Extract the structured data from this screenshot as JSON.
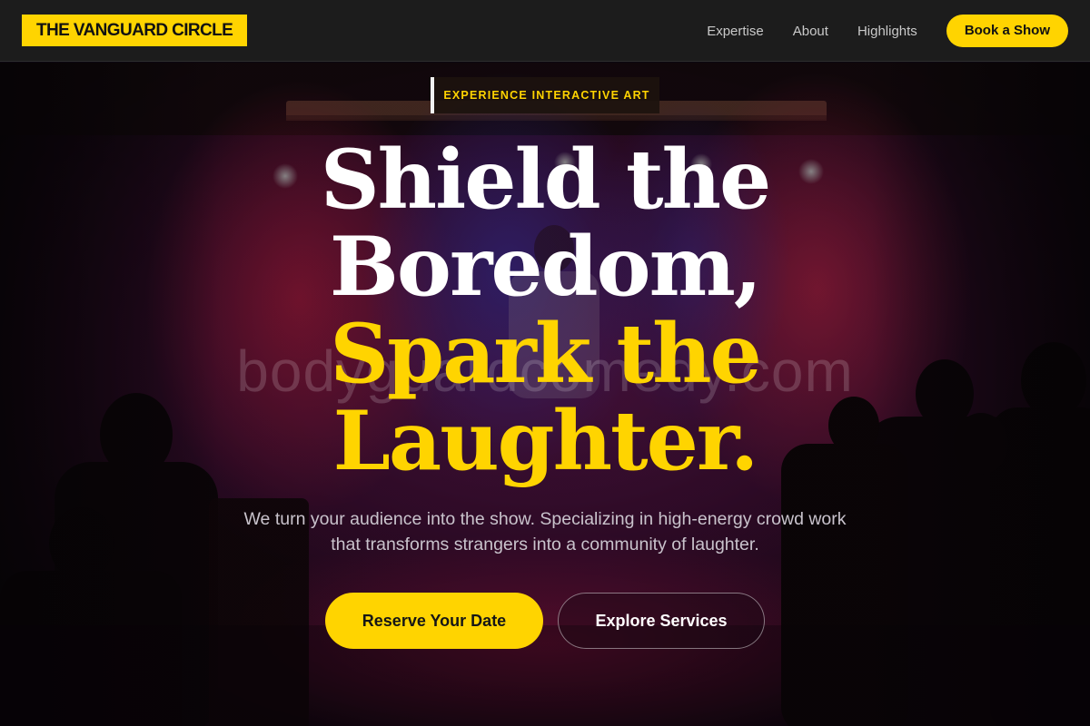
{
  "nav": {
    "logo": "THE VANGUARD CIRCLE",
    "links": [
      {
        "label": "Expertise"
      },
      {
        "label": "About"
      },
      {
        "label": "Highlights"
      }
    ],
    "cta": "Book a Show"
  },
  "hero": {
    "eyebrow": "EXPERIENCE INTERACTIVE ART",
    "headline": {
      "line1": "Shield the",
      "line2": "Boredom,",
      "line3": "Spark the",
      "line4": "Laughter."
    },
    "watermark": "bodyguardcomedy.com",
    "subtext": "We turn your audience into the show. Specializing in high-energy crowd work that transforms strangers into a community of laughter.",
    "primary_cta": "Reserve Your Date",
    "secondary_cta": "Explore Services"
  },
  "colors": {
    "accent": "#ffd400",
    "nav_bg": "#1c1c1c",
    "headline_white": "#ffffff"
  }
}
